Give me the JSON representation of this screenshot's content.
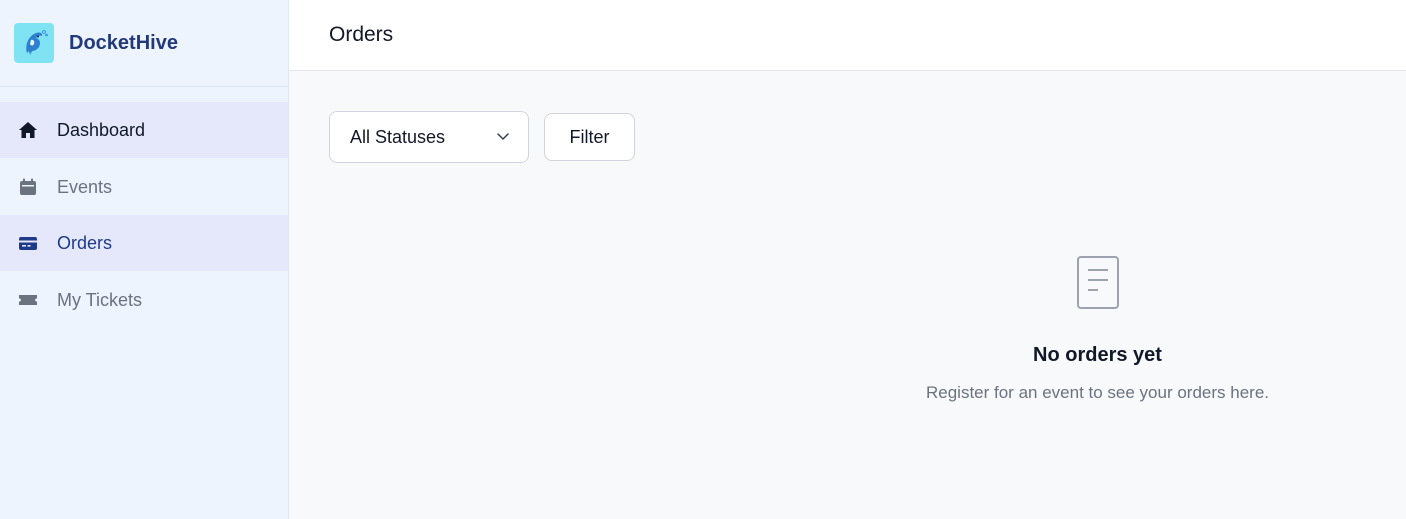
{
  "app": {
    "name": "DocketHive"
  },
  "sidebar": {
    "items": [
      {
        "label": "Dashboard",
        "icon": "home-icon"
      },
      {
        "label": "Events",
        "icon": "calendar-icon"
      },
      {
        "label": "Orders",
        "icon": "credit-card-icon"
      },
      {
        "label": "My Tickets",
        "icon": "ticket-icon"
      }
    ]
  },
  "header": {
    "title": "Orders"
  },
  "toolbar": {
    "status_select": {
      "value": "All Statuses"
    },
    "filter_label": "Filter"
  },
  "empty_state": {
    "icon": "document-icon",
    "title": "No orders yet",
    "description": "Register for an event to see your orders here."
  },
  "colors": {
    "brand_text": "#233a7a",
    "sidebar_bg": "#eef4fe",
    "active_bg": "#e4e8fa",
    "logo_bg": "#7fe3f3"
  }
}
